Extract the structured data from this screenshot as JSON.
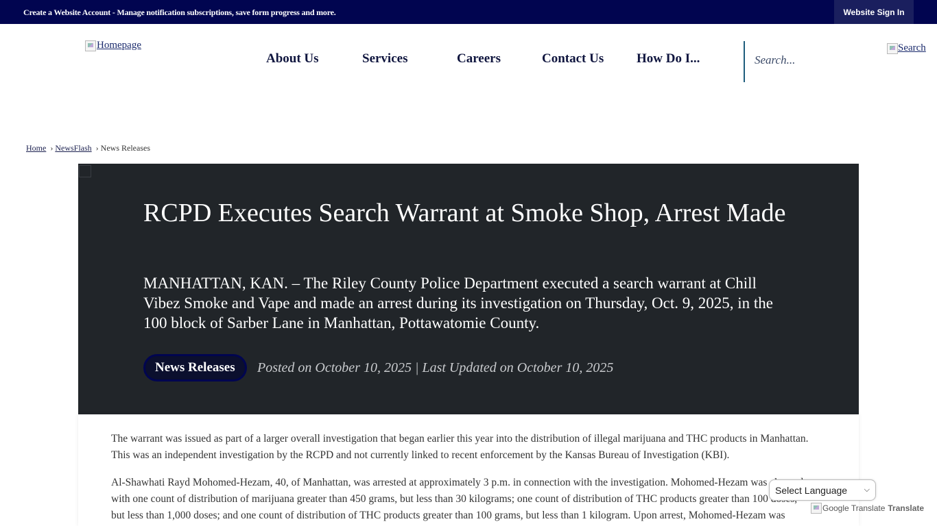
{
  "topbar": {
    "account_link": "Create a Website Account",
    "account_desc": " - Manage notification subscriptions, save form progress and more.",
    "sign_in": "Website Sign In"
  },
  "header": {
    "logo_alt": "Homepage",
    "nav": [
      {
        "label": "About Us"
      },
      {
        "label": "Services"
      },
      {
        "label": "Careers"
      },
      {
        "label": "Contact Us"
      },
      {
        "label": "How Do I..."
      }
    ],
    "search_placeholder": "Search...",
    "search_button_alt": "Search"
  },
  "breadcrumb": {
    "home": "Home",
    "newsflash": "NewsFlash",
    "current": "News Releases",
    "separator": "›"
  },
  "article": {
    "title": "RCPD Executes Search Warrant at Smoke Shop, Arrest Made",
    "lede": "MANHATTAN, KAN. – The Riley County Police Department executed a search warrant at Chill Vibez Smoke and Vape and made an arrest during its investigation on Thursday, Oct. 9, 2025, in the 100 block of Sarber Lane in Manhattan, Pottawatomie County.",
    "category": "News Releases",
    "meta": "Posted on October 10, 2025 | Last Updated on October 10, 2025",
    "paragraphs": [
      "The warrant was issued as part of a larger overall investigation that began earlier this year into the distribution of illegal marijuana and THC products in Manhattan. This was an independent investigation by the RCPD and not currently linked to recent enforcement by the Kansas Bureau of Investigation (KBI).",
      "Al-Shawhati Rayd Mohomed-Hezam, 40, of Manhattan, was arrested at approximately 3 p.m. in connection with the investigation. Mohomed-Hezam was charged with one count of distribution of marijuana greater than 450 grams, but less than 30 kilograms; one count of distribution of THC products greater than 100 doses, but less than 1,000 doses; and one count of distribution of THC products greater than 100 grams, but less than 1 kilogram. Upon arrest, Mohomed-Hezam was"
    ]
  },
  "translate": {
    "select_label": "Select Language",
    "google_alt": "Google Translate",
    "translate_text": "Translate"
  }
}
